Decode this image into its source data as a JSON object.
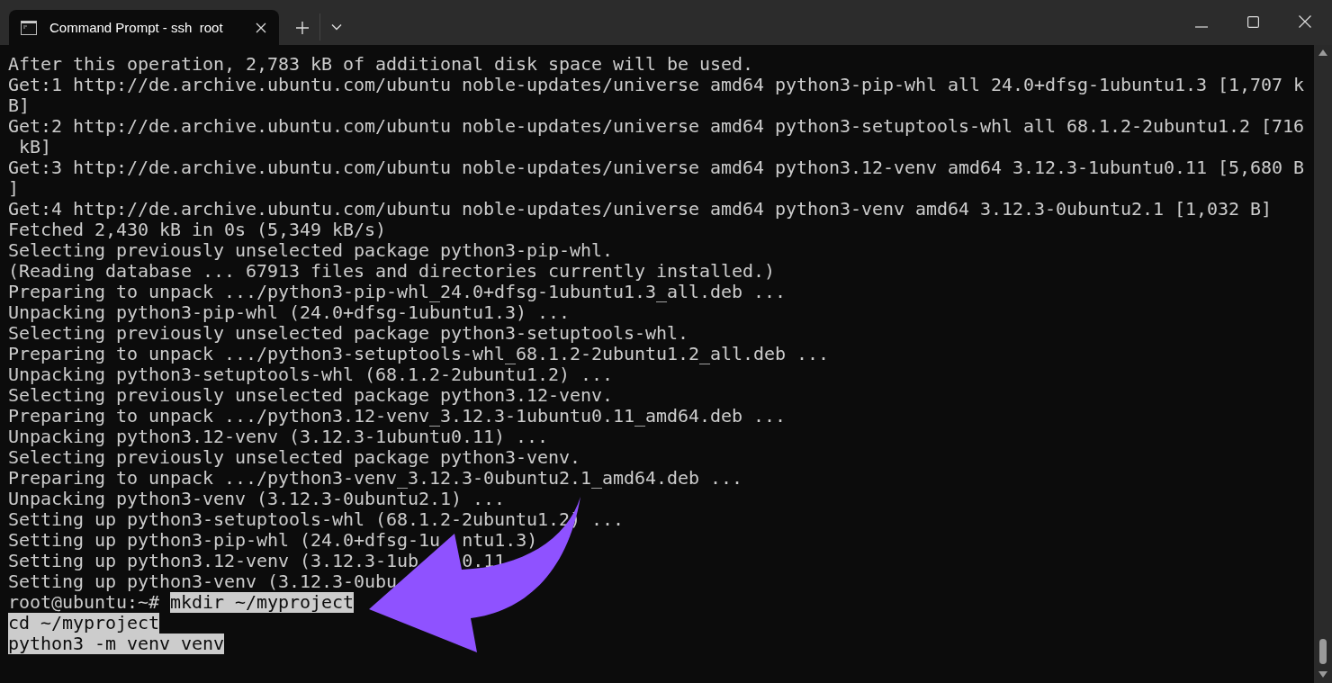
{
  "window": {
    "tab": {
      "title": "Command Prompt - ssh  root",
      "selected": true
    }
  },
  "terminal": {
    "lines": [
      {
        "text": "After this operation, 2,783 kB of additional disk space will be used.",
        "selected": false
      },
      {
        "text": "Get:1 http://de.archive.ubuntu.com/ubuntu noble-updates/universe amd64 python3-pip-whl all 24.0+dfsg-1ubuntu1.3 [1,707 k",
        "selected": false
      },
      {
        "text": "B]",
        "selected": false
      },
      {
        "text": "Get:2 http://de.archive.ubuntu.com/ubuntu noble-updates/universe amd64 python3-setuptools-whl all 68.1.2-2ubuntu1.2 [716",
        "selected": false
      },
      {
        "text": " kB]",
        "selected": false
      },
      {
        "text": "Get:3 http://de.archive.ubuntu.com/ubuntu noble-updates/universe amd64 python3.12-venv amd64 3.12.3-1ubuntu0.11 [5,680 B",
        "selected": false
      },
      {
        "text": "]",
        "selected": false
      },
      {
        "text": "Get:4 http://de.archive.ubuntu.com/ubuntu noble-updates/universe amd64 python3-venv amd64 3.12.3-0ubuntu2.1 [1,032 B]",
        "selected": false
      },
      {
        "text": "Fetched 2,430 kB in 0s (5,349 kB/s)",
        "selected": false
      },
      {
        "text": "Selecting previously unselected package python3-pip-whl.",
        "selected": false
      },
      {
        "text": "(Reading database ... 67913 files and directories currently installed.)",
        "selected": false
      },
      {
        "text": "Preparing to unpack .../python3-pip-whl_24.0+dfsg-1ubuntu1.3_all.deb ...",
        "selected": false
      },
      {
        "text": "Unpacking python3-pip-whl (24.0+dfsg-1ubuntu1.3) ...",
        "selected": false
      },
      {
        "text": "Selecting previously unselected package python3-setuptools-whl.",
        "selected": false
      },
      {
        "text": "Preparing to unpack .../python3-setuptools-whl_68.1.2-2ubuntu1.2_all.deb ...",
        "selected": false
      },
      {
        "text": "Unpacking python3-setuptools-whl (68.1.2-2ubuntu1.2) ...",
        "selected": false
      },
      {
        "text": "Selecting previously unselected package python3.12-venv.",
        "selected": false
      },
      {
        "text": "Preparing to unpack .../python3.12-venv_3.12.3-1ubuntu0.11_amd64.deb ...",
        "selected": false
      },
      {
        "text": "Unpacking python3.12-venv (3.12.3-1ubuntu0.11) ...",
        "selected": false
      },
      {
        "text": "Selecting previously unselected package python3-venv.",
        "selected": false
      },
      {
        "text": "Preparing to unpack .../python3-venv_3.12.3-0ubuntu2.1_amd64.deb ...",
        "selected": false
      },
      {
        "text": "Unpacking python3-venv (3.12.3-0ubuntu2.1) ...",
        "selected": false
      },
      {
        "text": "Setting up python3-setuptools-whl (68.1.2-2ubuntu1.2) ...",
        "selected": false
      },
      {
        "text": "Setting up python3-pip-whl (24.0+dfsg-1u",
        "selected": false,
        "parts": [
          "ntu1.3)"
        ]
      },
      {
        "text": "Setting up python3.12-venv (3.12.3-1ub",
        "selected": false,
        "parts": [
          "0.11"
        ]
      },
      {
        "text": "Setting up python3-venv (3.12.3-0ubu",
        "selected": false
      },
      {
        "prompt": "root@ubuntu:~# ",
        "text": "mkdir ~/myproject",
        "selected": true
      },
      {
        "text": "cd ~/myproject",
        "selected": true
      },
      {
        "text": "python3 -m venv venv",
        "selected": true
      }
    ]
  }
}
